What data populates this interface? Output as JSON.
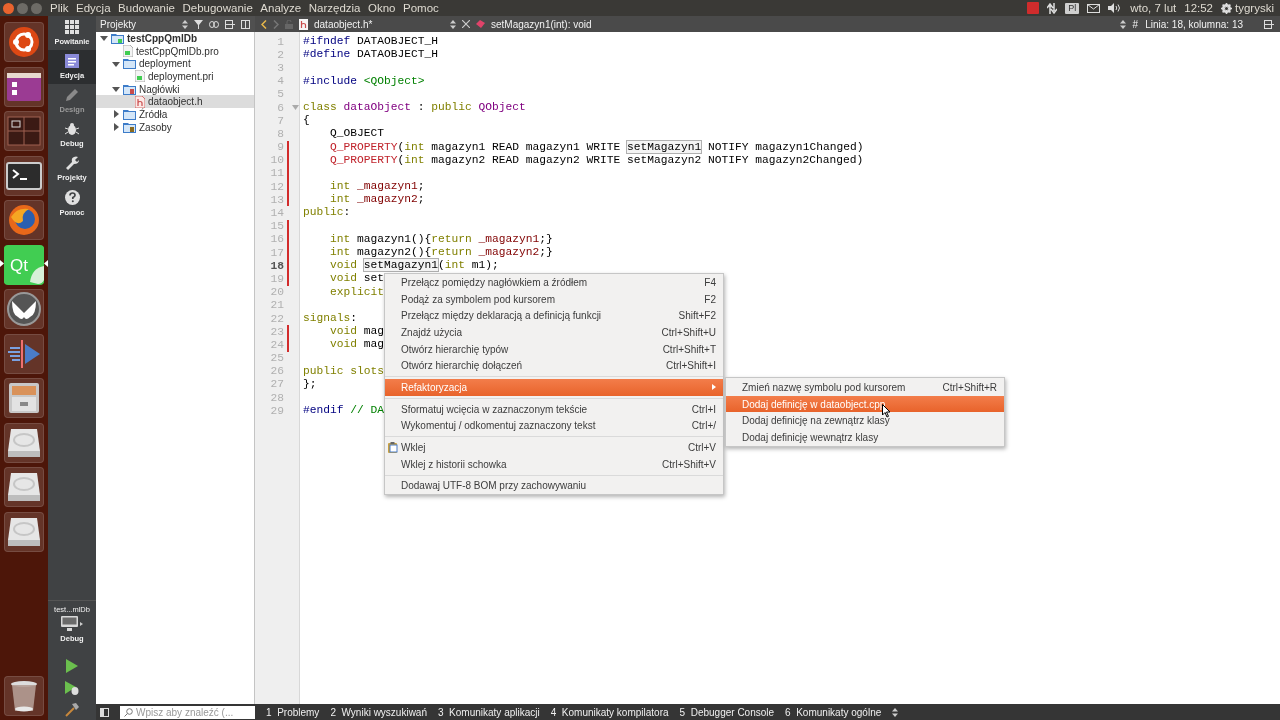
{
  "top_panel": {
    "menu": [
      "Plik",
      "Edycja",
      "Budowanie",
      "Debugowanie",
      "Analyze",
      "Narzędzia",
      "Okno",
      "Pomoc"
    ],
    "keyboard": "Pl",
    "date": "wto, 7 lut",
    "time": "12:52",
    "user": "tygryski"
  },
  "launcher": [
    {
      "kind": "home",
      "selected": false
    },
    {
      "kind": "workspace",
      "selected": false
    },
    {
      "kind": "switcher",
      "selected": false
    },
    {
      "kind": "terminal",
      "selected": false
    },
    {
      "kind": "browser",
      "selected": false
    },
    {
      "kind": "qt",
      "label": "Qt",
      "selected": true
    },
    {
      "kind": "butterfly",
      "selected": false
    },
    {
      "kind": "media",
      "selected": false
    },
    {
      "kind": "cabinet",
      "selected": false
    },
    {
      "kind": "drive",
      "selected": false
    },
    {
      "kind": "drive",
      "selected": false
    },
    {
      "kind": "drive",
      "selected": false
    },
    {
      "kind": "trash",
      "selected": false
    }
  ],
  "mode_bar": {
    "modes": [
      {
        "kind": "welcome",
        "label": "Powitanie",
        "selected": false,
        "disabled": false
      },
      {
        "kind": "edit",
        "label": "Edycja",
        "selected": true,
        "disabled": false
      },
      {
        "kind": "design",
        "label": "Design",
        "selected": false,
        "disabled": true
      },
      {
        "kind": "debug",
        "label": "Debug",
        "selected": false,
        "disabled": false
      },
      {
        "kind": "projects",
        "label": "Projekty",
        "selected": false,
        "disabled": false
      },
      {
        "kind": "help",
        "label": "Pomoc",
        "selected": false,
        "disabled": false
      }
    ],
    "project": "test...mlDb",
    "build": "Debug"
  },
  "project_panel": {
    "title": "Projekty",
    "tree": [
      {
        "label": "testCppQmlDb",
        "kind": "project",
        "expanded": true,
        "selected": false,
        "children": [
          {
            "label": "testCppQmlDb.pro",
            "kind": "pro",
            "selected": false
          },
          {
            "label": "deployment",
            "kind": "folder",
            "expanded": true,
            "selected": false,
            "children": [
              {
                "label": "deployment.pri",
                "kind": "pro",
                "selected": false
              }
            ]
          },
          {
            "label": "Nagłówki",
            "kind": "headers",
            "expanded": true,
            "selected": false,
            "children": [
              {
                "label": "dataobject.h",
                "kind": "header",
                "selected": true
              }
            ]
          },
          {
            "label": "Źródła",
            "kind": "folder",
            "expanded": false,
            "selected": false
          },
          {
            "label": "Zasoby",
            "kind": "resources",
            "expanded": false,
            "selected": false
          }
        ]
      }
    ]
  },
  "editor": {
    "file": "dataobject.h*",
    "symbol": "setMagazyn1(int): void",
    "hash": "#",
    "position": "Linia: 18, kolumna: 13",
    "lines": [
      {
        "n": "1",
        "changed": false,
        "current": false,
        "fold": false,
        "tokens": [
          {
            "kind": "pp",
            "t": "#ifndef"
          },
          {
            "kind": "plain",
            "t": " DATAOBJECT_H"
          }
        ]
      },
      {
        "n": "2",
        "changed": false,
        "current": false,
        "fold": false,
        "tokens": [
          {
            "kind": "pp",
            "t": "#define"
          },
          {
            "kind": "plain",
            "t": " DATAOBJECT_H"
          }
        ]
      },
      {
        "n": "3",
        "changed": false,
        "current": false,
        "fold": false
      },
      {
        "n": "4",
        "changed": false,
        "current": false,
        "fold": false,
        "tokens": [
          {
            "kind": "pp",
            "t": "#include "
          },
          {
            "kind": "str",
            "t": "<QObject>"
          }
        ]
      },
      {
        "n": "5",
        "changed": false,
        "current": false,
        "fold": false
      },
      {
        "n": "6",
        "changed": false,
        "current": false,
        "fold": true,
        "tokens": [
          {
            "kind": "kw",
            "t": "class "
          },
          {
            "kind": "type",
            "t": "dataObject"
          },
          {
            "kind": "plain",
            "t": " : "
          },
          {
            "kind": "kw",
            "t": "public "
          },
          {
            "kind": "type",
            "t": "QObject"
          }
        ]
      },
      {
        "n": "7",
        "changed": false,
        "current": false,
        "fold": false,
        "tokens": [
          {
            "kind": "plain",
            "t": "{"
          }
        ]
      },
      {
        "n": "8",
        "changed": false,
        "current": false,
        "fold": false,
        "tokens": [
          {
            "kind": "plain",
            "t": "    Q_OBJECT"
          }
        ]
      },
      {
        "n": "9",
        "changed": true,
        "current": false,
        "fold": false,
        "tokens": [
          {
            "kind": "macro",
            "t": "    Q_PROPERTY"
          },
          {
            "kind": "plain",
            "t": "("
          },
          {
            "kind": "kw",
            "t": "int"
          },
          {
            "kind": "plain",
            "t": " magazyn1 READ magazyn1 WRITE "
          },
          {
            "kind": "box",
            "t": "setMagazyn1"
          },
          {
            "kind": "plain",
            "t": " NOTIFY magazyn1Changed)"
          }
        ]
      },
      {
        "n": "10",
        "changed": true,
        "current": false,
        "fold": false,
        "tokens": [
          {
            "kind": "macro",
            "t": "    Q_PROPERTY"
          },
          {
            "kind": "plain",
            "t": "("
          },
          {
            "kind": "kw",
            "t": "int"
          },
          {
            "kind": "plain",
            "t": " magazyn2 READ magazyn2 WRITE setMagazyn2 NOTIFY magazyn2Changed)"
          }
        ]
      },
      {
        "n": "11",
        "changed": true,
        "current": false,
        "fold": false
      },
      {
        "n": "12",
        "changed": true,
        "current": false,
        "fold": false,
        "tokens": [
          {
            "kind": "kw",
            "t": "    int "
          },
          {
            "kind": "field",
            "t": "_magazyn1"
          },
          {
            "kind": "plain",
            "t": ";"
          }
        ]
      },
      {
        "n": "13",
        "changed": true,
        "current": false,
        "fold": false,
        "tokens": [
          {
            "kind": "kw",
            "t": "    int "
          },
          {
            "kind": "field",
            "t": "_magazyn2"
          },
          {
            "kind": "plain",
            "t": ";"
          }
        ]
      },
      {
        "n": "14",
        "changed": false,
        "current": false,
        "fold": false,
        "tokens": [
          {
            "kind": "kw",
            "t": "public"
          },
          {
            "kind": "plain",
            "t": ":"
          }
        ]
      },
      {
        "n": "15",
        "changed": true,
        "current": false,
        "fold": false
      },
      {
        "n": "16",
        "changed": true,
        "current": false,
        "fold": false,
        "tokens": [
          {
            "kind": "kw",
            "t": "    int"
          },
          {
            "kind": "plain",
            "t": " magazyn1(){"
          },
          {
            "kind": "kw",
            "t": "return "
          },
          {
            "kind": "field",
            "t": "_magazyn1"
          },
          {
            "kind": "plain",
            "t": ";}"
          }
        ]
      },
      {
        "n": "17",
        "changed": true,
        "current": false,
        "fold": false,
        "tokens": [
          {
            "kind": "kw",
            "t": "    int"
          },
          {
            "kind": "plain",
            "t": " magazyn2(){"
          },
          {
            "kind": "kw",
            "t": "return "
          },
          {
            "kind": "field",
            "t": "_magazyn2"
          },
          {
            "kind": "plain",
            "t": ";}"
          }
        ]
      },
      {
        "n": "18",
        "changed": true,
        "current": true,
        "fold": false,
        "tokens": [
          {
            "kind": "kw",
            "t": "    void "
          },
          {
            "kind": "box",
            "t": "setMagazyn1"
          },
          {
            "kind": "plain",
            "t": "("
          },
          {
            "kind": "kw",
            "t": "int"
          },
          {
            "kind": "plain",
            "t": " m1);"
          }
        ]
      },
      {
        "n": "19",
        "changed": true,
        "current": false,
        "fold": false,
        "tokens": [
          {
            "kind": "kw",
            "t": "    void"
          },
          {
            "kind": "plain",
            "t": " set"
          }
        ]
      },
      {
        "n": "20",
        "changed": false,
        "current": false,
        "fold": false,
        "tokens": [
          {
            "kind": "kw",
            "t": "    explicit"
          }
        ]
      },
      {
        "n": "21",
        "changed": false,
        "current": false,
        "fold": false
      },
      {
        "n": "22",
        "changed": false,
        "current": false,
        "fold": false,
        "tokens": [
          {
            "kind": "kw",
            "t": "signals"
          },
          {
            "kind": "plain",
            "t": ":"
          }
        ]
      },
      {
        "n": "23",
        "changed": true,
        "current": false,
        "fold": false,
        "tokens": [
          {
            "kind": "kw",
            "t": "    void"
          },
          {
            "kind": "plain",
            "t": " mag"
          }
        ]
      },
      {
        "n": "24",
        "changed": true,
        "current": false,
        "fold": false,
        "tokens": [
          {
            "kind": "kw",
            "t": "    void"
          },
          {
            "kind": "plain",
            "t": " mag"
          }
        ]
      },
      {
        "n": "25",
        "changed": false,
        "current": false,
        "fold": false
      },
      {
        "n": "26",
        "changed": false,
        "current": false,
        "fold": false,
        "tokens": [
          {
            "kind": "kw",
            "t": "public slots"
          }
        ]
      },
      {
        "n": "27",
        "changed": false,
        "current": false,
        "fold": false,
        "tokens": [
          {
            "kind": "plain",
            "t": "};"
          }
        ]
      },
      {
        "n": "28",
        "changed": false,
        "current": false,
        "fold": false
      },
      {
        "n": "29",
        "changed": false,
        "current": false,
        "fold": false,
        "tokens": [
          {
            "kind": "pp",
            "t": "#endif "
          },
          {
            "kind": "comment",
            "t": "// DA"
          }
        ]
      }
    ]
  },
  "context_menu": {
    "items": [
      {
        "kind": "item",
        "label": "Przełącz pomiędzy nagłówkiem a źródłem",
        "shortcut": "F4",
        "selected": false
      },
      {
        "kind": "item",
        "label": "Podąż za symbolem pod kursorem",
        "shortcut": "F2",
        "selected": false
      },
      {
        "kind": "item",
        "label": "Przełącz między deklaracją a definicją funkcji",
        "shortcut": "Shift+F2",
        "selected": false
      },
      {
        "kind": "item",
        "label": "Znajdź użycia",
        "shortcut": "Ctrl+Shift+U",
        "selected": false
      },
      {
        "kind": "item",
        "label": "Otwórz hierarchię typów",
        "shortcut": "Ctrl+Shift+T",
        "selected": false
      },
      {
        "kind": "item",
        "label": "Otwórz hierarchię dołączeń",
        "shortcut": "Ctrl+Shift+I",
        "selected": false
      },
      {
        "kind": "separator"
      },
      {
        "kind": "submenu",
        "label": "Refaktoryzacja",
        "selected": true
      },
      {
        "kind": "separator"
      },
      {
        "kind": "item",
        "label": "Sformatuj wcięcia w zaznaczonym tekście",
        "shortcut": "Ctrl+I",
        "selected": false
      },
      {
        "kind": "item",
        "label": "Wykomentuj / odkomentuj zaznaczony tekst",
        "shortcut": "Ctrl+/",
        "selected": false
      },
      {
        "kind": "separator"
      },
      {
        "kind": "paste",
        "label": "Wklej",
        "shortcut": "Ctrl+V",
        "selected": false
      },
      {
        "kind": "item",
        "label": "Wklej z historii schowka",
        "shortcut": "Ctrl+Shift+V",
        "selected": false
      },
      {
        "kind": "separator"
      },
      {
        "kind": "item",
        "label": "Dodawaj UTF-8 BOM przy zachowywaniu",
        "selected": false
      }
    ]
  },
  "submenu": {
    "items": [
      {
        "label": "Zmień nazwę symbolu pod kursorem",
        "shortcut": "Ctrl+Shift+R",
        "selected": false
      },
      {
        "label": "Dodaj definicję w dataobject.cpp",
        "selected": true
      },
      {
        "label": "Dodaj definicję na zewnątrz klasy",
        "selected": false
      },
      {
        "label": "Dodaj definicję wewnątrz klasy",
        "selected": false
      }
    ]
  },
  "output_bar": {
    "placeholder": "Wpisz aby znaleźć (...",
    "tabs": [
      {
        "num": "1",
        "label": "Problemy"
      },
      {
        "num": "2",
        "label": "Wyniki wyszukiwań"
      },
      {
        "num": "3",
        "label": "Komunikaty aplikacji"
      },
      {
        "num": "4",
        "label": "Komunikaty kompilatora"
      },
      {
        "num": "5",
        "label": "Debugger Console"
      },
      {
        "num": "6",
        "label": "Komunikaty ogólne"
      }
    ]
  }
}
